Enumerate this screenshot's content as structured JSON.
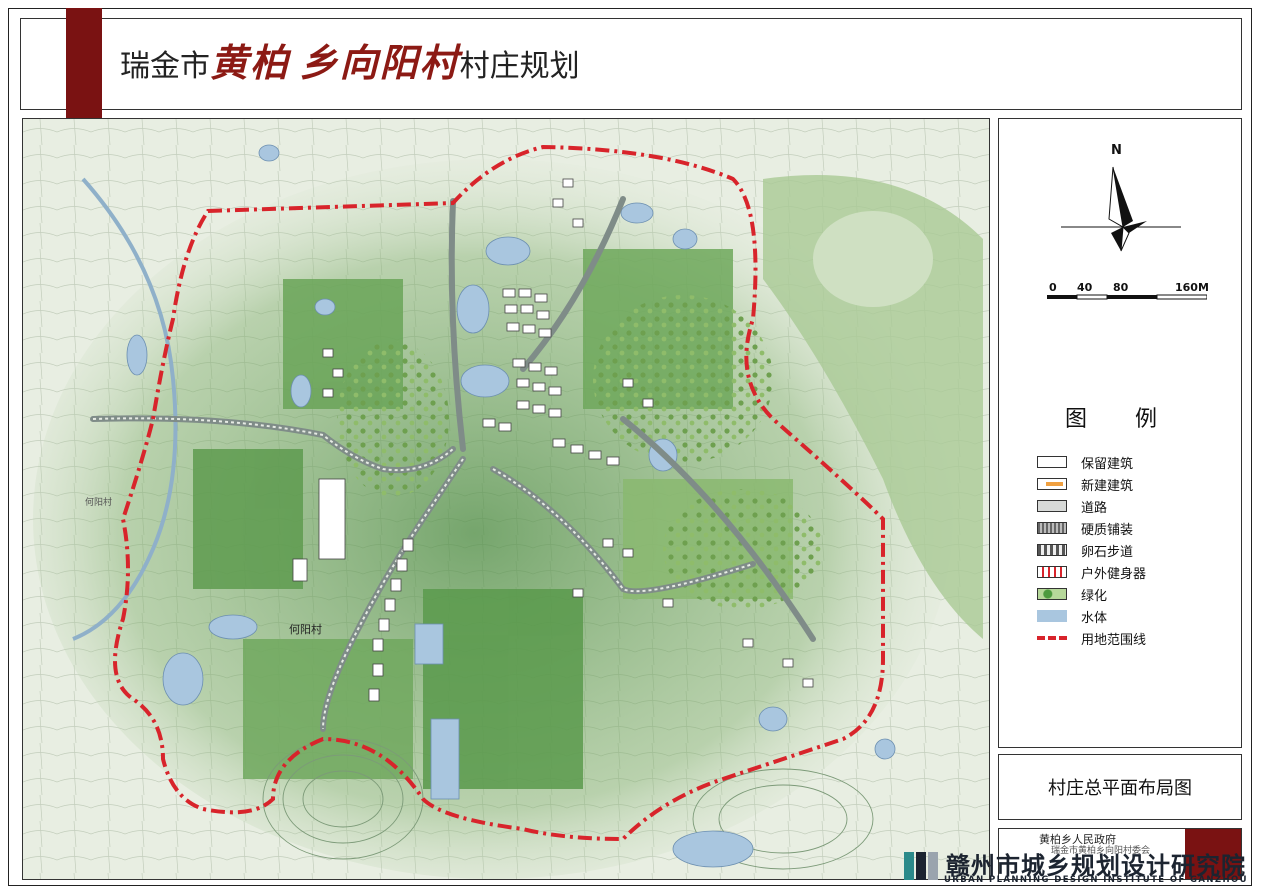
{
  "title": {
    "prefix": "瑞金市",
    "callig_1": "黄柏",
    "callig_2": "乡向阳村",
    "suffix": "村庄规划"
  },
  "map": {
    "village_label_1": "何阳村",
    "village_label_2": "何阳村",
    "colors": {
      "boundary": "#d8242b",
      "road": "#7f8c88",
      "water": "#a9c6df",
      "green_dark": "#4f8d45",
      "green_light": "#a8c98e"
    }
  },
  "legend": {
    "north": "N",
    "scale": [
      "0",
      "40",
      "80",
      "160M"
    ],
    "title": "图例",
    "items": [
      {
        "label": "保留建筑",
        "icon": "retained-building-icon"
      },
      {
        "label": "新建建筑",
        "icon": "new-building-icon"
      },
      {
        "label": "道路",
        "icon": "road-icon"
      },
      {
        "label": "硬质铺装",
        "icon": "hard-paving-icon"
      },
      {
        "label": "卵石步道",
        "icon": "pebble-path-icon"
      },
      {
        "label": "户外健身器",
        "icon": "fitness-equipment-icon"
      },
      {
        "label": "绿化",
        "icon": "greenery-icon"
      },
      {
        "label": "水体",
        "icon": "water-icon"
      },
      {
        "label": "用地范围线",
        "icon": "boundary-line-icon"
      }
    ]
  },
  "drawing_name": "村庄总平面布局图",
  "client": {
    "line1": "黄柏乡人民政府",
    "line2": "瑞金市黄柏乡向阳村委会"
  },
  "organization": {
    "cn": "赣州市城乡规划设计研究院",
    "en": "URBAN PLANNING DESIGN INSTITUTE OF GANZHOU"
  }
}
